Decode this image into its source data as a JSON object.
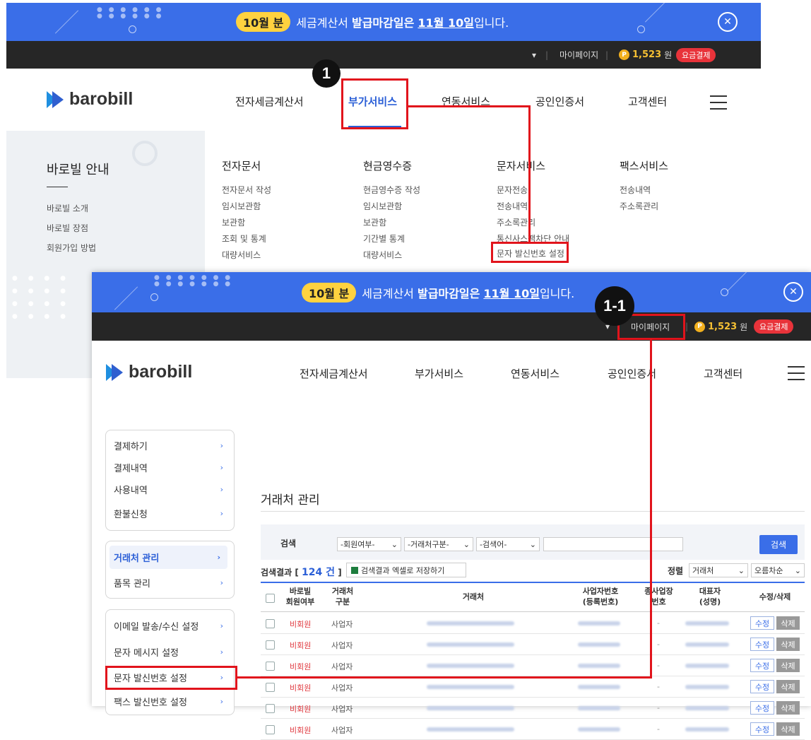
{
  "banner": {
    "pill": "10월 분",
    "text_before": "세금계산서",
    "text_bold": "발급마감일은",
    "text_date": "11월 10일",
    "text_after": "입니다."
  },
  "topbar": {
    "dropdown_arrow": "▾",
    "mypage": "마이페이지",
    "coin": "P",
    "points": "1,523",
    "unit": "원",
    "pay": "요금결제"
  },
  "logo": {
    "text": "barobill"
  },
  "gnb": [
    "전자세금계산서",
    "부가서비스",
    "연동서비스",
    "공인인증서",
    "고객센터"
  ],
  "mega": {
    "left_title": "바로빌 안내",
    "left_links": [
      "바로빌 소개",
      "바로빌 장점",
      "회원가입 방법"
    ],
    "columns": [
      {
        "title": "전자문서",
        "links": [
          "전자문서 작성",
          "임시보관함",
          "보관함",
          "조회 및 통계",
          "대량서비스"
        ]
      },
      {
        "title": "현금영수증",
        "links": [
          "현금영수증 작성",
          "임시보관함",
          "보관함",
          "기간별 통계",
          "대량서비스"
        ]
      },
      {
        "title": "문자서비스",
        "links": [
          "문자전송",
          "전송내역",
          "주소록관리",
          "통신사스팸차단 안내",
          "문자 발신번호 설정"
        ]
      },
      {
        "title": "팩스서비스",
        "links": [
          "전송내역",
          "주소록관리"
        ]
      }
    ]
  },
  "badges": {
    "step1": "1",
    "step1_1": "1-1"
  },
  "sidebar": {
    "group1": [
      "결제하기",
      "결제내역",
      "사용내역",
      "환불신청"
    ],
    "group2": [
      "거래처 관리",
      "품목 관리"
    ],
    "group3": [
      "이메일 발송/수신 설정",
      "문자 메시지 설정",
      "문자 발신번호 설정",
      "팩스 발신번호 설정"
    ],
    "chevron": "›"
  },
  "content": {
    "title": "거래처 관리",
    "search_label": "검색",
    "filters": [
      "-회원여부-",
      "-거래처구분-",
      "-검색어-"
    ],
    "search_value": "",
    "search_button": "검색",
    "result_prefix": "검색결과 [",
    "result_count": "124 건",
    "result_suffix": "]",
    "excel_button": "검색결과 엑셀로 저장하기",
    "sort_label": "정렬",
    "sort_field": "거래처",
    "sort_order": "오름차순"
  },
  "table": {
    "headers": {
      "member_l1": "바로빌",
      "member_l2": "회원여부",
      "type_l1": "거래처",
      "type_l2": "구분",
      "name": "거래처",
      "bizno_l1": "사업자번호",
      "bizno_l2": "(등록번호)",
      "branch_l1": "종사업장",
      "branch_l2": "번호",
      "ceo_l1": "대표자",
      "ceo_l2": "(성명)",
      "action": "수정/삭제"
    },
    "rows": [
      {
        "member": "비회원",
        "type": "사업자",
        "branch": "-"
      },
      {
        "member": "비회원",
        "type": "사업자",
        "branch": "-"
      },
      {
        "member": "비회원",
        "type": "사업자",
        "branch": "-"
      },
      {
        "member": "비회원",
        "type": "사업자",
        "branch": "-"
      },
      {
        "member": "비회원",
        "type": "사업자",
        "branch": "-"
      },
      {
        "member": "비회원",
        "type": "사업자",
        "branch": "-"
      }
    ],
    "edit": "수정",
    "delete": "삭제"
  },
  "colors": {
    "brand_blue": "#3a6ee8",
    "highlight_red": "#e1141c",
    "member_red": "#e0383e"
  }
}
